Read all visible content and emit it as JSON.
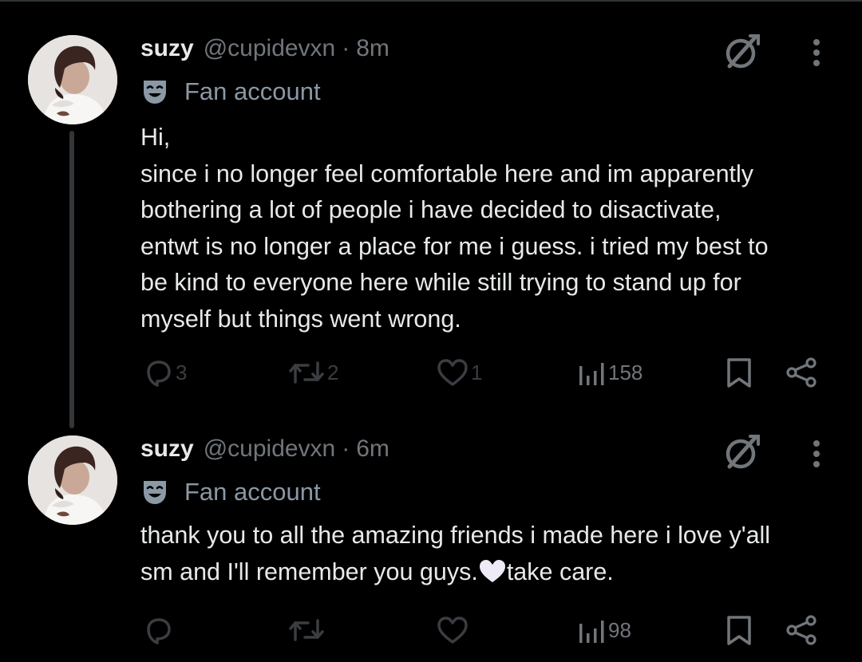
{
  "tweets": [
    {
      "author": {
        "name": "suzy",
        "handle": "@cupidevxn",
        "time": "8m",
        "label": "Fan account"
      },
      "text_lines": [
        "Hi,",
        "since i no longer feel comfortable here and im apparently",
        "bothering a lot of people i have decided to disactivate,",
        "entwt is no longer a place for me i guess. i tried my best to",
        "be kind to everyone here while still trying to stand up for",
        "myself but things went wrong."
      ],
      "stats": {
        "replies": "3",
        "reposts": "2",
        "likes": "1",
        "views": "158"
      }
    },
    {
      "author": {
        "name": "suzy",
        "handle": "@cupidevxn",
        "time": "6m",
        "label": "Fan account"
      },
      "text_lines": [
        "thank you to all the amazing friends i made here i love y'all",
        "sm and I'll remember you guys.",
        "take care."
      ],
      "stats": {
        "replies": "",
        "reposts": "",
        "likes": "",
        "views": "98"
      }
    }
  ],
  "separator": "·",
  "icons": {
    "label": "theater-mask-icon",
    "grok": "grok-icon",
    "more": "more-vertical-icon",
    "reply": "reply-icon",
    "repost": "repost-icon",
    "like": "heart-icon",
    "views": "views-icon",
    "bookmark": "bookmark-icon",
    "share": "share-icon"
  },
  "colors": {
    "background": "#000000",
    "text": "#e7e9ea",
    "secondary": "#71767b",
    "stats_dim": "#3a3d41"
  }
}
